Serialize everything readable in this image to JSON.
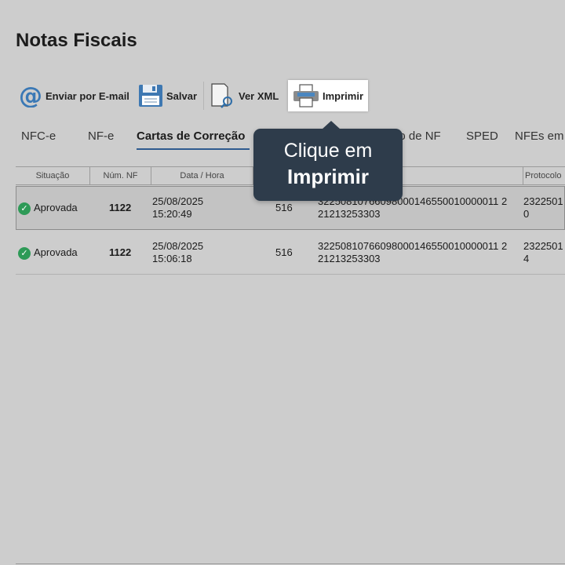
{
  "page": {
    "title": "Notas Fiscais"
  },
  "toolbar": {
    "email_label": "Enviar por E-mail",
    "save_label": "Salvar",
    "xml_label": "Ver XML",
    "print_label": "Imprimir"
  },
  "tabs": [
    {
      "label": "NFC-e",
      "active": false
    },
    {
      "label": "NF-e",
      "active": false
    },
    {
      "label": "Cartas de Correção",
      "active": true
    },
    {
      "label": "ão de NF",
      "active": false
    },
    {
      "label": "SPED",
      "active": false
    },
    {
      "label": "NFEs em",
      "active": false
    }
  ],
  "table": {
    "columns": [
      "Situação",
      "Núm. NF",
      "Data / Hora",
      "",
      "",
      "Protocolo"
    ],
    "rows": [
      {
        "status": "Aprovada",
        "num": "1122",
        "date": "25/08/2025",
        "time": "15:20:49",
        "seq": "516",
        "key1": "32250810766098000146550010000011 2",
        "key2": "21213253303",
        "protocol1": "2322501",
        "protocol2": "0",
        "selected": true
      },
      {
        "status": "Aprovada",
        "num": "1122",
        "date": "25/08/2025",
        "time": "15:06:18",
        "seq": "516",
        "key1": "32250810766098000146550010000011 2",
        "key2": "21213253303",
        "protocol1": "2322501",
        "protocol2": "4",
        "selected": false
      }
    ]
  },
  "tooltip": {
    "line1": "Clique em",
    "line2": "Imprimir"
  },
  "colors": {
    "background": "#cdcdcd",
    "tooltip_bg": "#2e3c4b",
    "accent": "#2f5b8f",
    "success": "#2e9a57"
  }
}
